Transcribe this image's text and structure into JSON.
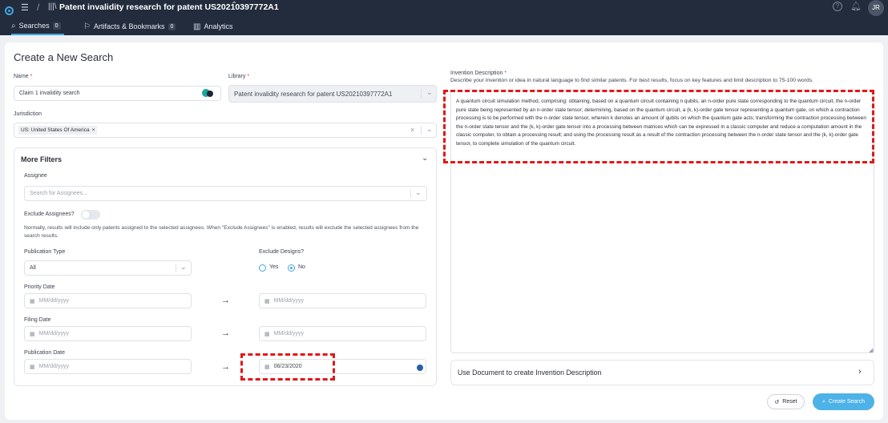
{
  "topbar": {
    "title": "Patent invalidity research for patent US20210397772A1",
    "user_initials": "JR",
    "icons": [
      "app-logo-icon",
      "menu-icon",
      "library-icon",
      "chevron-updown-icon",
      "help-icon",
      "bell-icon"
    ]
  },
  "tabs": [
    {
      "label": "Searches",
      "badge": "0",
      "icon": "search-icon",
      "active": true
    },
    {
      "label": "Artifacts & Bookmarks",
      "badge": "0",
      "icon": "bookmark-icon",
      "active": false
    },
    {
      "label": "Analytics",
      "badge": "",
      "icon": "chart-icon",
      "active": false
    }
  ],
  "page_title": "Create a New Search",
  "form": {
    "name_label": "Name",
    "name_value": "Claim 1 invalidity search",
    "library_label": "Library",
    "library_value": "Patent invalidity research for patent US20210397772A1",
    "jurisdiction_label": "Jurisdiction",
    "jurisdiction_chip": "US: United States Of America",
    "required_mark": "*"
  },
  "filters": {
    "title": "More Filters",
    "assignee_label": "Assignee",
    "assignee_placeholder": "Search for Assignees...",
    "exclude_assignees_label": "Exclude Assignees?",
    "exclude_assignees_on": false,
    "note": "Normally, results will include only patents assigned to the selected assignees. When \"Exclude Assignees\" is enabled, results will exclude the selected assignees from the search results.",
    "publication_type_label": "Publication Type",
    "publication_type_value": "All",
    "exclude_designs_label": "Exclude Designs?",
    "exclude_designs_yes": "Yes",
    "exclude_designs_no": "No",
    "exclude_designs_selected": "No",
    "priority_date_label": "Priority Date",
    "filing_date_label": "Filing Date",
    "publication_date_label": "Publication Date",
    "date_placeholder": "MM/dd/yyyy",
    "publication_date_to": "06/23/2020"
  },
  "invention": {
    "label": "Invention Description",
    "hint": "Describe your invention or idea in natural language to find similar patents. For best results, focus on key features and limit description to 75-100 words.",
    "text": "A quantum circuit simulation method, comprising: obtaining, based on a quantum circuit containing n qubits, an n-order pure state corresponding to the quantum circuit, the n-order pure state being represented by an n-order state tensor; determining, based on the quantum circuit, a (k, k)-order gate tensor representing a quantum gate, on which a contraction processing is to be performed with the n-order state tensor, wherein k denotes an amount of qubits on which the quantum gate acts; transforming the contraction processing between the n-order state tensor and the (k, k)-order gate tensor into a processing between matrices which can be expressed in a classic computer and reduce a computation amount in the classic computer, to obtain a processing result; and using the processing result as a result of the contraction processing between the n-order state tensor and the (k, k)-order gate tensor, to complete simulation of the quantum circuit.",
    "use_document_label": "Use Document to create Invention Description"
  },
  "actions": {
    "reset_label": "Reset",
    "create_label": "Create Search"
  },
  "colors": {
    "topbar": "#232c3d",
    "accent": "#3fa7e0",
    "create_button": "#4db2e8",
    "highlight": "#e01818"
  }
}
